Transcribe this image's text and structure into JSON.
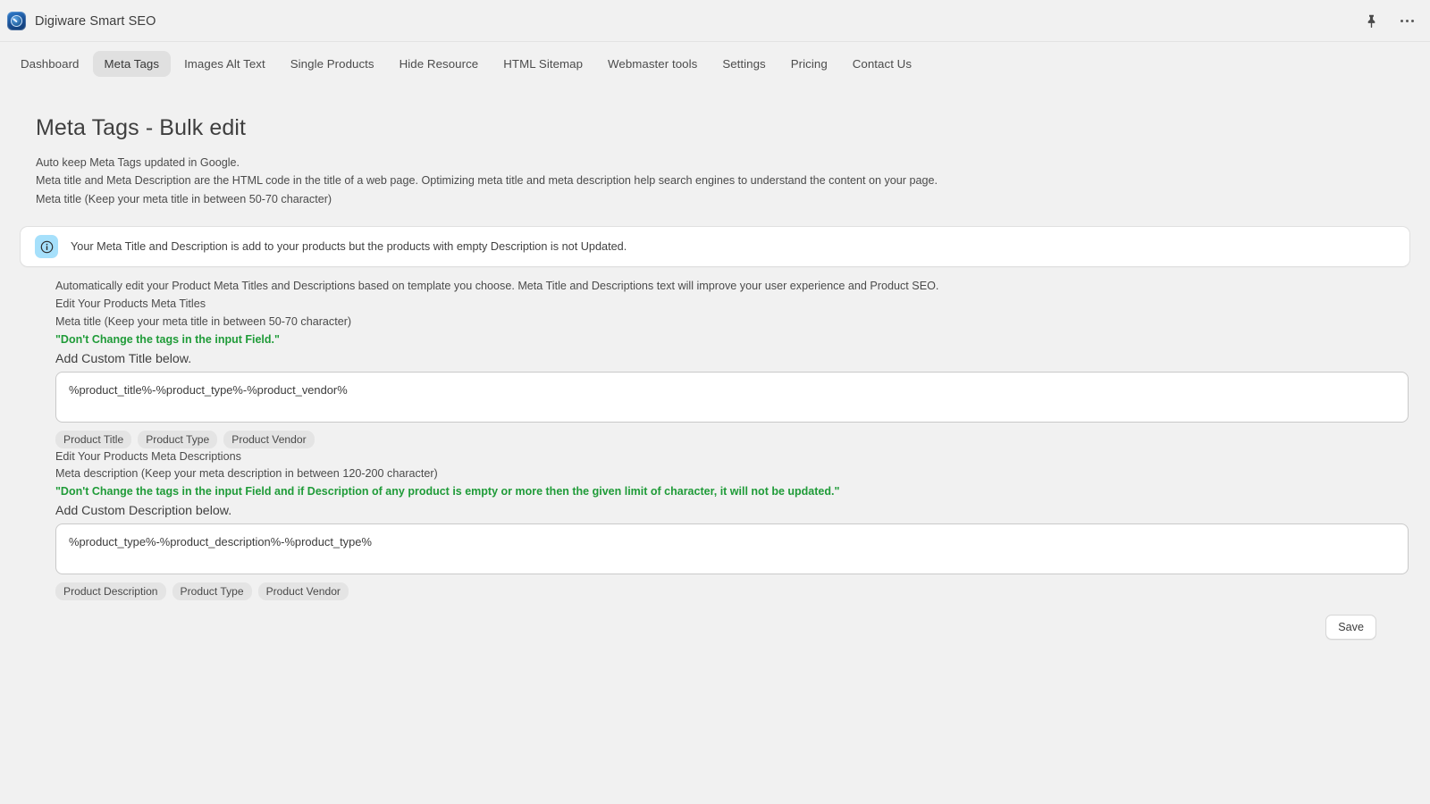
{
  "app": {
    "title": "Digiware Smart SEO",
    "icon": "speedometer-app-icon",
    "pin_icon": "pin-icon",
    "more_icon": "more-horizontal-icon"
  },
  "nav": {
    "items": [
      {
        "label": "Dashboard",
        "active": false
      },
      {
        "label": "Meta Tags",
        "active": true
      },
      {
        "label": "Images Alt Text",
        "active": false
      },
      {
        "label": "Single Products",
        "active": false
      },
      {
        "label": "Hide Resource",
        "active": false
      },
      {
        "label": "HTML Sitemap",
        "active": false
      },
      {
        "label": "Webmaster tools",
        "active": false
      },
      {
        "label": "Settings",
        "active": false
      },
      {
        "label": "Pricing",
        "active": false
      },
      {
        "label": "Contact Us",
        "active": false
      }
    ]
  },
  "page": {
    "title": "Meta Tags - Bulk edit",
    "intro_line_1": "Auto keep Meta Tags updated in Google.",
    "intro_line_2": "Meta title and Meta Description are the HTML code in the title of a web page. Optimizing meta title and meta description help search engines to understand the content on your page.",
    "intro_line_3": "Meta title (Keep your meta title in between 50-70 character)"
  },
  "banner": {
    "icon": "info-circle-icon",
    "icon_bg": "#a6e0fb",
    "text": "Your Meta Title and Description is add to your products but the products with empty Description is not Updated."
  },
  "form": {
    "description_line": "Automatically edit your Product Meta Titles and Descriptions based on template you choose. Meta Title and Descriptions text will improve your user experience and Product SEO.",
    "title_section": {
      "heading": "Edit Your Products Meta Titles",
      "hint": "Meta title (Keep your meta title in between 50-70 character)",
      "warning": "\"Don't Change the tags in the input Field.\"",
      "warning_color": "#1f9b38",
      "field_label": "Add Custom Title below.",
      "value": "%product_title%-%product_type%-%product_vendor%",
      "placeholder": "%product_title%-%product_type%-%product_vendor%",
      "chips": [
        "Product Title",
        "Product Type",
        "Product Vendor"
      ]
    },
    "description_section": {
      "heading": "Edit Your Products Meta Descriptions",
      "hint": "Meta description (Keep your meta description in between 120-200 character)",
      "warning": "\"Don't Change the tags in the input Field and if Description of any product is empty or more then the given limit of character, it will not be updated.\"",
      "warning_color": "#1f9b38",
      "field_label": "Add Custom Description below.",
      "value": "%product_type%-%product_description%-%product_type%",
      "placeholder": "%product_type%-%product_description%-%product_type%",
      "chips": [
        "Product Description",
        "Product Type",
        "Product Vendor"
      ]
    },
    "save_label": "Save"
  }
}
